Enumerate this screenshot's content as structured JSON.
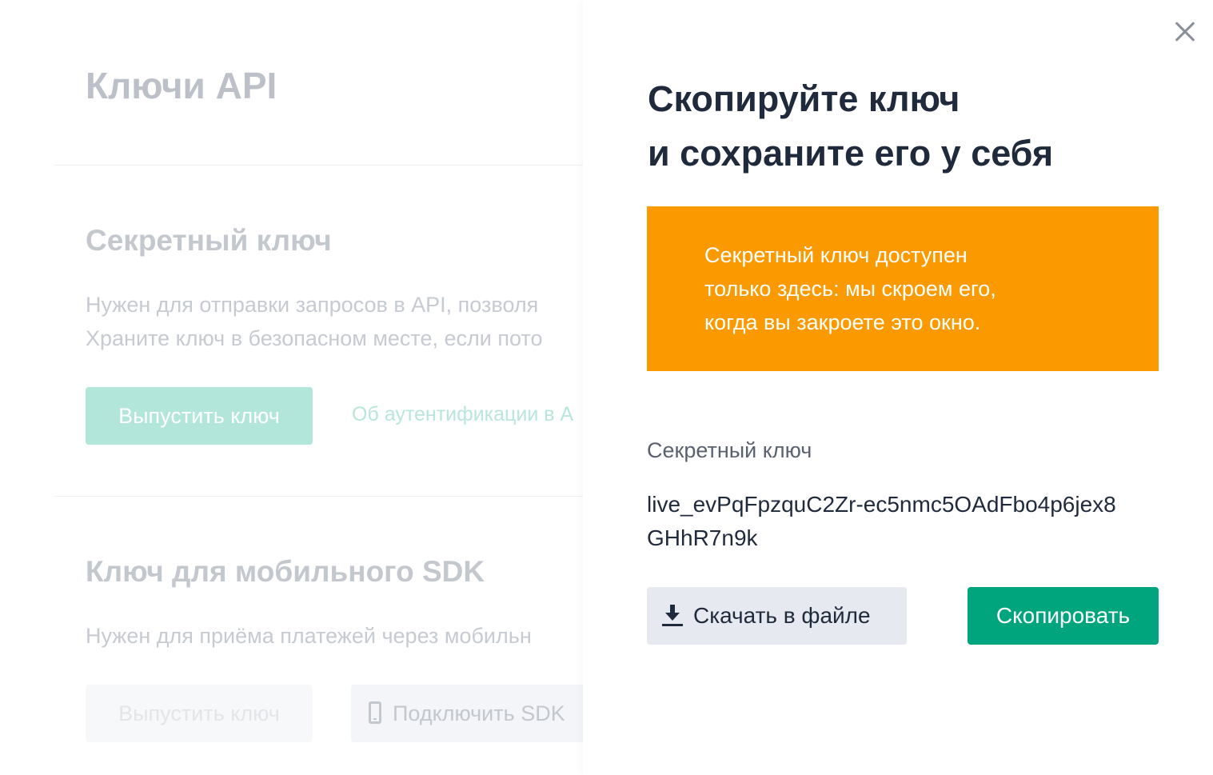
{
  "background": {
    "title": "Ключи API",
    "secret_section": {
      "heading": "Секретный ключ",
      "desc_line1": "Нужен для отправки запросов в API, позволя",
      "desc_line2": "Храните ключ в безопасном месте, если пото",
      "issue_button": "Выпустить ключ",
      "auth_link": "Об аутентификации в А"
    },
    "sdk_section": {
      "heading": "Ключ для мобильного SDK",
      "desc_line1": "Нужен для приёма платежей через мобильн",
      "issue_button": "Выпустить ключ",
      "connect_button": "Подключить SDK"
    }
  },
  "drawer": {
    "title_line1": "Скопируйте ключ",
    "title_line2": "и сохраните его у себя",
    "warning_line1": "Секретный ключ доступен",
    "warning_line2": "только здесь: мы скроем его,",
    "warning_line3": "когда вы закроете это окно.",
    "key_label": "Секретный ключ",
    "key_line1": "live_evPqFpzquC2Zr-ec5nmc5OAdFbo4p6jex8",
    "key_line2": "GHhR7n9k",
    "download_button": "Скачать в файле",
    "copy_button": "Скопировать",
    "icons": {
      "close": "close-icon",
      "download": "download-icon",
      "phone": "phone-icon"
    },
    "colors": {
      "warning": "#fa9a00",
      "primary": "#00a57e"
    }
  }
}
